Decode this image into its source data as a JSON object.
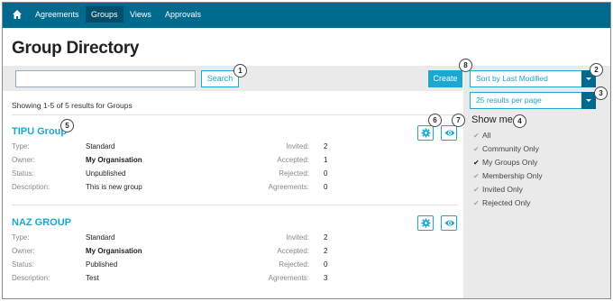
{
  "nav": {
    "items": [
      "Agreements",
      "Groups",
      "Views",
      "Approvals"
    ],
    "active": "Groups"
  },
  "page": {
    "title": "Group Directory"
  },
  "search": {
    "placeholder": "",
    "button_label": "Search"
  },
  "create_label": "Create",
  "sort": {
    "selected": "Sort by Last Modified"
  },
  "page_size": {
    "selected": "25 results per page"
  },
  "show_me": {
    "title": "Show me",
    "filters": [
      {
        "label": "All",
        "selected": false
      },
      {
        "label": "Community Only",
        "selected": false
      },
      {
        "label": "My Groups Only",
        "selected": true
      },
      {
        "label": "Membership Only",
        "selected": false
      },
      {
        "label": "Invited Only",
        "selected": false
      },
      {
        "label": "Rejected Only",
        "selected": false
      }
    ]
  },
  "results_summary": "Showing 1-5 of 5 results for Groups",
  "field_labels": {
    "type": "Type:",
    "owner": "Owner:",
    "status": "Status:",
    "description": "Description:",
    "invited": "Invited:",
    "accepted": "Accepted:",
    "rejected": "Rejected:",
    "agreements": "Agreements:"
  },
  "groups": [
    {
      "name": "TIPU Group",
      "type": "Standard",
      "owner": "My Organisation",
      "status": "Unpublished",
      "description": "This is new group",
      "invited": "2",
      "accepted": "1",
      "rejected": "0",
      "agreements": "0"
    },
    {
      "name": "NAZ GROUP",
      "type": "Standard",
      "owner": "My Organisation",
      "status": "Published",
      "description": "Test",
      "invited": "2",
      "accepted": "2",
      "rejected": "0",
      "agreements": "3"
    }
  ],
  "callouts": [
    "1",
    "2",
    "3",
    "4",
    "5",
    "6",
    "7",
    "8"
  ],
  "colors": {
    "nav_bg": "#006a8e",
    "accent": "#1ba7cf",
    "panel_bg": "#eaeaea"
  }
}
